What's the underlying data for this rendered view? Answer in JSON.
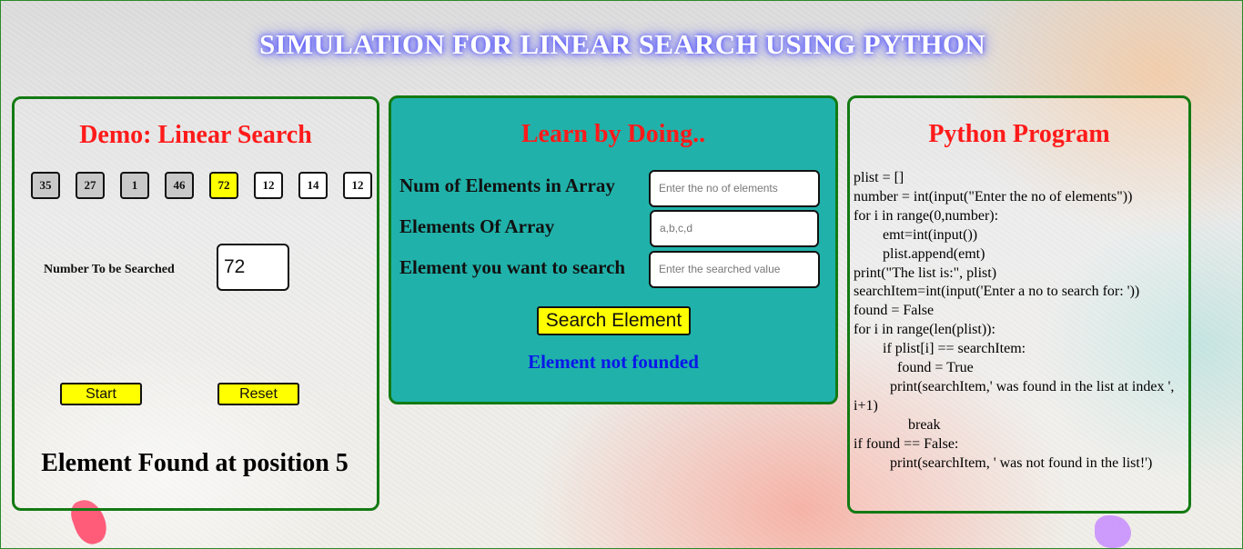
{
  "page": {
    "title": "SIMULATION FOR LINEAR SEARCH USING PYTHON"
  },
  "demo": {
    "heading": "Demo: Linear Search",
    "array": [
      {
        "value": "35",
        "state": "visited",
        "color": "#c9c9c9"
      },
      {
        "value": "27",
        "state": "visited",
        "color": "#c9c9c9"
      },
      {
        "value": "1",
        "state": "visited",
        "color": "#c9c9c9"
      },
      {
        "value": "46",
        "state": "visited",
        "color": "#c9c9c9"
      },
      {
        "value": "72",
        "state": "found",
        "color": "#ffff00"
      },
      {
        "value": "12",
        "state": "unvisited",
        "color": "#ffffff"
      },
      {
        "value": "14",
        "state": "unvisited",
        "color": "#ffffff"
      },
      {
        "value": "12",
        "state": "unvisited",
        "color": "#ffffff"
      }
    ],
    "search_label": "Number To be Searched",
    "search_value": "72",
    "start_label": "Start",
    "reset_label": "Reset",
    "result": "Element Found at position 5"
  },
  "learn": {
    "heading": "Learn by Doing..",
    "num_elements_label": "Num of Elements in Array",
    "num_elements_placeholder": "Enter the no of elements",
    "elements_label": "Elements Of Array",
    "elements_placeholder": "a,b,c,d",
    "search_label": "Element you want to search",
    "search_placeholder": "Enter the searched value",
    "search_button": "Search Element",
    "status": "Element not founded"
  },
  "code": {
    "heading": "Python Program",
    "lines": [
      "plist = []",
      "number = int(input(\"Enter the no of elements\"))",
      "for i in range(0,number):",
      "        emt=int(input())",
      "        plist.append(emt)",
      "print(\"The list is:\", plist)",
      "searchItem=int(input('Enter a no to search for: '))",
      "found = False",
      "for i in range(len(plist)):",
      "        if plist[i] == searchItem:",
      "            found = True",
      "          print(searchItem,' was found in the list at index ', i+1)",
      "               break",
      "if found == False:",
      "          print(searchItem, ' was not found in the list!')"
    ]
  },
  "colors": {
    "accent_red": "#ff1a1a",
    "panel_border": "#137a13",
    "learn_bg": "#20b2aa",
    "button_yellow": "#ffff00",
    "status_blue": "#0a18e8"
  }
}
